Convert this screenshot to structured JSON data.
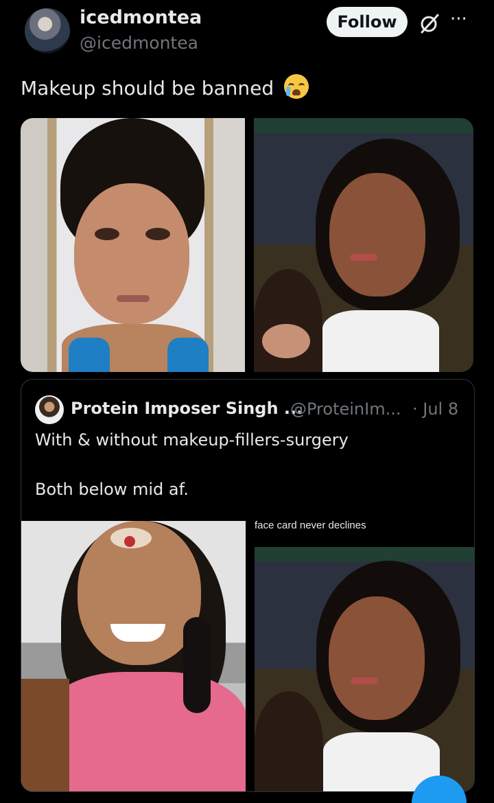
{
  "author": {
    "display_name": "icedmontea",
    "handle": "@icedmontea",
    "follow_label": "Follow"
  },
  "icons": {
    "grok": "grok-icon",
    "more": "more-horizontal-icon",
    "emoji": "loudly-crying-face-emoji"
  },
  "tweet": {
    "text": "Makeup should be banned"
  },
  "quote": {
    "author_name": "Protein Imposer Singh ...",
    "author_handle": "@ProteinIm...",
    "date": "· Jul 8",
    "line1": "With & without makeup-fillers-surgery",
    "line2": "Both below mid af.",
    "image_caption": "face card never declines"
  },
  "colors": {
    "background": "#000000",
    "text": "#e7e9ea",
    "secondary_text": "#71767b",
    "accent": "#1d9bf0"
  }
}
